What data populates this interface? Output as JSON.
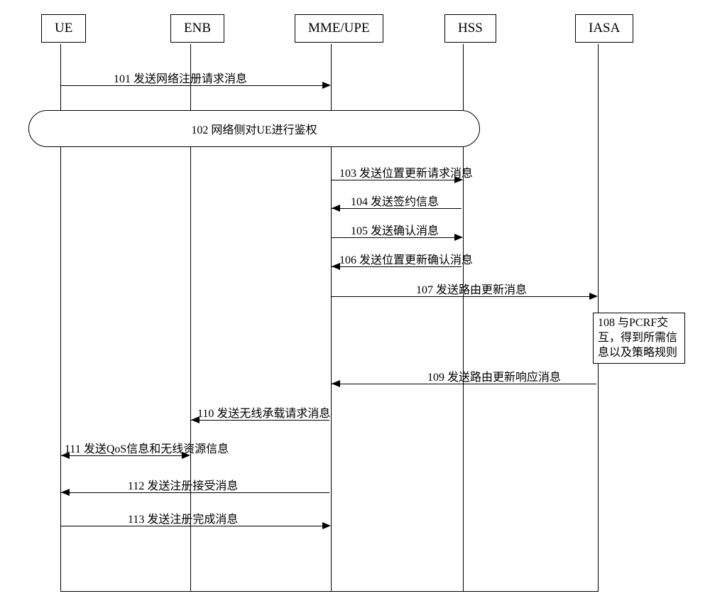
{
  "participants": {
    "ue": {
      "label": "UE"
    },
    "enb": {
      "label": "ENB"
    },
    "mme": {
      "label": "MME/UPE"
    },
    "hss": {
      "label": "HSS"
    },
    "iasa": {
      "label": "IASA"
    }
  },
  "oval": {
    "auth": "102 网络侧对UE进行鉴权"
  },
  "messages": {
    "m101": "101 发送网络注册请求消息",
    "m103": "103 发送位置更新请求消息",
    "m104": "104 发送签约信息",
    "m105": "105 发送确认消息",
    "m106": "106 发送位置更新确认消息",
    "m107": "107 发送路由更新消息",
    "m109": "109 发送路由更新响应消息",
    "m110": "110 发送无线承载请求消息",
    "m111": "111 发送QoS信息和无线资源信息",
    "m112": "112 发送注册接受消息",
    "m113": "113 发送注册完成消息"
  },
  "notes": {
    "n108": "108 与PCRF交\n互，得到所需信\n息以及策略规则"
  }
}
